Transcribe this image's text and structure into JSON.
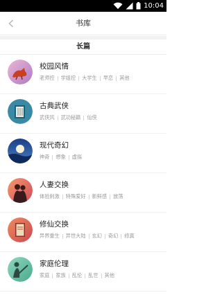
{
  "status_bar": {
    "time": "10:04"
  },
  "nav": {
    "title": "书库"
  },
  "section": {
    "title": "长篇"
  },
  "categories": [
    {
      "title": "校园风情",
      "icon": "fox-icon",
      "color": "#d9a1c8",
      "tags": [
        "老师控",
        "学姐控",
        "大学生",
        "早恋",
        "其他"
      ]
    },
    {
      "title": "古典武侠",
      "icon": "scroll-book-icon",
      "color": "#3a8aa6",
      "tags": [
        "武侠风",
        "武功秘籍",
        "仙侠"
      ]
    },
    {
      "title": "现代奇幻",
      "icon": "moon-landscape-icon",
      "color": "#2a4f92",
      "tags": [
        "神奇",
        "想象",
        "虚拟"
      ]
    },
    {
      "title": "人妻交换",
      "icon": "couple-icon",
      "color": "#e8795a",
      "tags": [
        "体验刺激",
        "特殊爱好",
        "新鲜感",
        "放荡"
      ]
    },
    {
      "title": "修仙交换",
      "icon": "book-icon",
      "color": "#e0705a",
      "tags": [
        "异界重生",
        "异世大陆",
        "玄幻",
        "奇幻",
        "修真"
      ]
    },
    {
      "title": "家庭伦理",
      "icon": "guitar-player-icon",
      "color": "#6fc6a9",
      "tags": [
        "家庭",
        "家族",
        "乱伦",
        "乱世",
        "其他"
      ]
    }
  ]
}
